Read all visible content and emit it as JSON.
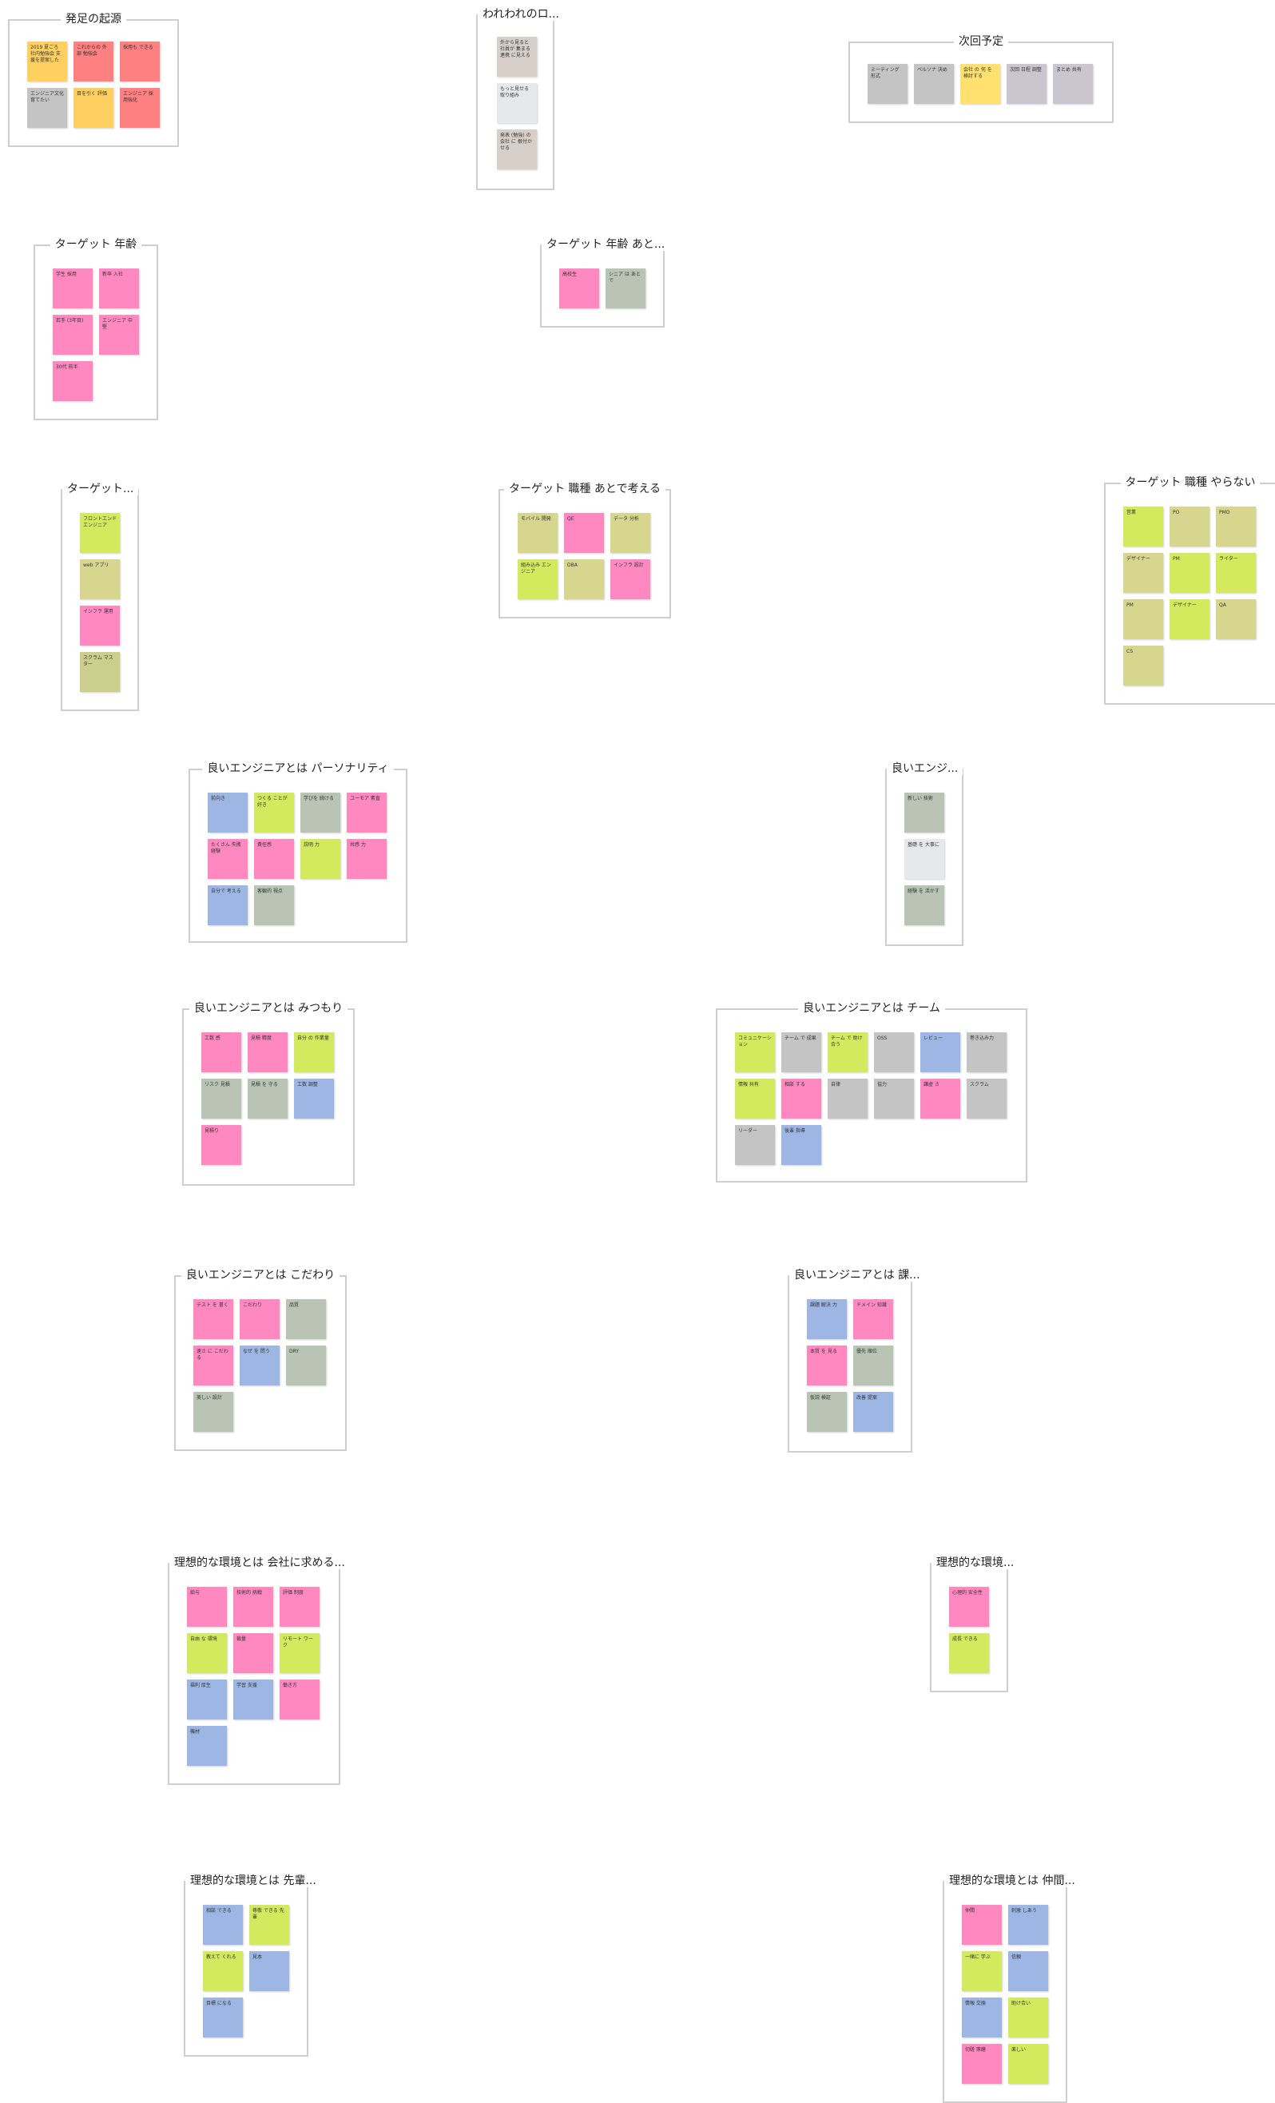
{
  "colors": {
    "pink": "#ff88c0",
    "red": "#ff8080",
    "orange": "#ffd060",
    "yellow": "#ffe070",
    "lime": "#d4ea5e",
    "khaki": "#d6d68e",
    "olive": "#cccf8c",
    "gray": "#c4c4c4",
    "sage": "#b9c4b4",
    "lightgray": "#e6e8ea",
    "blue": "#9db6e4",
    "mauve": "#c9c6cf",
    "tan": "#d8d0c8"
  },
  "frames": [
    {
      "id": "f1",
      "title": "発足の起源",
      "notes": [
        {
          "color": "orange",
          "text": "2019 夏ごろ 社内勉強会 支援を提案した"
        },
        {
          "color": "red",
          "text": "これからの 外部 勉強会"
        },
        {
          "color": "red",
          "text": "採用も できる"
        },
        {
          "color": "gray",
          "text": "エンジニア文化 育てたい"
        },
        {
          "color": "orange",
          "text": "目を引く 評価"
        },
        {
          "color": "red",
          "text": "エンジニア 採用強化"
        }
      ]
    },
    {
      "id": "f2",
      "title": "われわれのロ...",
      "notes": [
        {
          "color": "tan",
          "text": "外から見ると 社員が 集まる 連携 に見える"
        },
        {
          "color": "lightgray",
          "text": "もっと見せる 取り組み"
        },
        {
          "color": "tan",
          "text": "発表 (勉強) の 会社 に 根付かせる"
        }
      ]
    },
    {
      "id": "f3",
      "title": "次回予定",
      "notes": [
        {
          "color": "gray",
          "text": "ミーティング 形式"
        },
        {
          "color": "gray",
          "text": "ペルソナ 決め"
        },
        {
          "color": "yellow",
          "text": "会社 の 何 を 検討する"
        },
        {
          "color": "mauve",
          "text": "次回 日程 調整"
        },
        {
          "color": "mauve",
          "text": "まとめ 共有"
        }
      ]
    },
    {
      "id": "f4",
      "title": "ターゲット 年齢",
      "notes": [
        {
          "color": "pink",
          "text": "学生 採用"
        },
        {
          "color": "pink",
          "text": "新卒 入社"
        },
        {
          "color": "pink",
          "text": "若手 (3年目)"
        },
        {
          "color": "pink",
          "text": "エンジニア 中堅"
        },
        {
          "color": "pink",
          "text": "30代 前半"
        }
      ]
    },
    {
      "id": "f5",
      "title": "ターゲット 年齢 あと...",
      "notes": [
        {
          "color": "pink",
          "text": "高校生"
        },
        {
          "color": "sage",
          "text": "シニア は あとで"
        }
      ]
    },
    {
      "id": "f6",
      "title": "ターゲット...",
      "notes": [
        {
          "color": "lime",
          "text": "フロントエンド エンジニア"
        },
        {
          "color": "khaki",
          "text": "web アプリ"
        },
        {
          "color": "pink",
          "text": "インフラ 運用"
        },
        {
          "color": "olive",
          "text": "スクラム マスター"
        }
      ]
    },
    {
      "id": "f7",
      "title": "ターゲット 職種 あとで考える",
      "notes": [
        {
          "color": "khaki",
          "text": "モバイル 開発"
        },
        {
          "color": "pink",
          "text": "QE"
        },
        {
          "color": "khaki",
          "text": "データ 分析"
        },
        {
          "color": "lime",
          "text": "組み込み エンジニア"
        },
        {
          "color": "khaki",
          "text": "DBA"
        },
        {
          "color": "pink",
          "text": "インフラ 設計"
        }
      ]
    },
    {
      "id": "f8",
      "title": "ターゲット 職種 やらない",
      "notes": [
        {
          "color": "lime",
          "text": "営業"
        },
        {
          "color": "khaki",
          "text": "PO"
        },
        {
          "color": "khaki",
          "text": "PMO"
        },
        {
          "color": "khaki",
          "text": "デザイナー"
        },
        {
          "color": "lime",
          "text": "PM"
        },
        {
          "color": "lime",
          "text": "ライター"
        },
        {
          "color": "khaki",
          "text": "PM"
        },
        {
          "color": "lime",
          "text": "デザイナー"
        },
        {
          "color": "khaki",
          "text": "QA"
        },
        {
          "color": "khaki",
          "text": "CS"
        }
      ]
    },
    {
      "id": "f9",
      "title": "良いエンジニアとは パーソナリティ",
      "notes": [
        {
          "color": "blue",
          "text": "前向き"
        },
        {
          "color": "lime",
          "text": "つくる ことが好き"
        },
        {
          "color": "sage",
          "text": "学びを 続ける"
        },
        {
          "color": "pink",
          "text": "ユーモア 素直"
        },
        {
          "color": "pink",
          "text": "たくさん 失敗 経験"
        },
        {
          "color": "pink",
          "text": "責任感"
        },
        {
          "color": "lime",
          "text": "説明 力"
        },
        {
          "color": "pink",
          "text": "共感 力"
        },
        {
          "color": "blue",
          "text": "自分で 考える"
        },
        {
          "color": "sage",
          "text": "客観的 視点"
        }
      ]
    },
    {
      "id": "f10",
      "title": "良いエンジ...",
      "notes": [
        {
          "color": "sage",
          "text": "新しい 技術"
        },
        {
          "color": "lightgray",
          "text": "基礎 を 大事に"
        },
        {
          "color": "sage",
          "text": "経験 を 活かす"
        }
      ]
    },
    {
      "id": "f11",
      "title": "良いエンジニアとは みつもり",
      "notes": [
        {
          "color": "pink",
          "text": "工数 感"
        },
        {
          "color": "pink",
          "text": "見積 精度"
        },
        {
          "color": "lime",
          "text": "自分 の 作業量"
        },
        {
          "color": "sage",
          "text": "リスク 見積"
        },
        {
          "color": "sage",
          "text": "見積 を 守る"
        },
        {
          "color": "blue",
          "text": "工数 調整"
        },
        {
          "color": "pink",
          "text": "見積り"
        }
      ]
    },
    {
      "id": "f12",
      "title": "良いエンジニアとは チーム",
      "notes": [
        {
          "color": "lime",
          "text": "コミュニケーション"
        },
        {
          "color": "gray",
          "text": "チーム で 成果"
        },
        {
          "color": "lime",
          "text": "チーム で 助け合う"
        },
        {
          "color": "gray",
          "text": "OSS"
        },
        {
          "color": "blue",
          "text": "レビュー"
        },
        {
          "color": "gray",
          "text": "巻き込み力"
        },
        {
          "color": "lime",
          "text": "情報 共有"
        },
        {
          "color": "pink",
          "text": "相談 する"
        },
        {
          "color": "gray",
          "text": "自律"
        },
        {
          "color": "gray",
          "text": "協力"
        },
        {
          "color": "pink",
          "text": "謙虚 さ"
        },
        {
          "color": "gray",
          "text": "スクラム"
        },
        {
          "color": "gray",
          "text": "リーダー"
        },
        {
          "color": "blue",
          "text": "後輩 指導"
        }
      ]
    },
    {
      "id": "f13",
      "title": "良いエンジニアとは こだわり",
      "notes": [
        {
          "color": "pink",
          "text": "テスト を 書く"
        },
        {
          "color": "pink",
          "text": "こだわり"
        },
        {
          "color": "sage",
          "text": "品質"
        },
        {
          "color": "pink",
          "text": "速さ に こだわる"
        },
        {
          "color": "blue",
          "text": "なぜ を 問う"
        },
        {
          "color": "sage",
          "text": "DRY"
        },
        {
          "color": "sage",
          "text": "美しい 設計"
        }
      ]
    },
    {
      "id": "f14",
      "title": "良いエンジニアとは 課...",
      "notes": [
        {
          "color": "blue",
          "text": "課題 解決 力"
        },
        {
          "color": "pink",
          "text": "ドメイン 知識"
        },
        {
          "color": "pink",
          "text": "本質 を 見る"
        },
        {
          "color": "sage",
          "text": "優先 順位"
        },
        {
          "color": "sage",
          "text": "仮説 検証"
        },
        {
          "color": "blue",
          "text": "改善 提案"
        }
      ]
    },
    {
      "id": "f15",
      "title": "理想的な環境とは 会社に求める...",
      "notes": [
        {
          "color": "pink",
          "text": "給与"
        },
        {
          "color": "pink",
          "text": "技術的 挑戦"
        },
        {
          "color": "pink",
          "text": "評価 制度"
        },
        {
          "color": "lime",
          "text": "自由 な 環境"
        },
        {
          "color": "pink",
          "text": "裁量"
        },
        {
          "color": "lime",
          "text": "リモート ワーク"
        },
        {
          "color": "blue",
          "text": "福利 厚生"
        },
        {
          "color": "blue",
          "text": "学習 支援"
        },
        {
          "color": "pink",
          "text": "働き方"
        },
        {
          "color": "blue",
          "text": "機材"
        }
      ]
    },
    {
      "id": "f16",
      "title": "理想的な環境...",
      "notes": [
        {
          "color": "pink",
          "text": "心理的 安全性"
        },
        {
          "color": "lime",
          "text": "成長 できる"
        }
      ]
    },
    {
      "id": "f17",
      "title": "理想的な環境とは 先輩...",
      "notes": [
        {
          "color": "blue",
          "text": "相談 できる"
        },
        {
          "color": "lime",
          "text": "尊敬 できる 先輩"
        },
        {
          "color": "lime",
          "text": "教えて くれる"
        },
        {
          "color": "blue",
          "text": "見本"
        },
        {
          "color": "blue",
          "text": "目標 になる"
        }
      ]
    },
    {
      "id": "f18",
      "title": "理想的な環境とは 仲間...",
      "notes": [
        {
          "color": "pink",
          "text": "仲間"
        },
        {
          "color": "blue",
          "text": "刺激 しあう"
        },
        {
          "color": "lime",
          "text": "一緒に 学ぶ"
        },
        {
          "color": "blue",
          "text": "信頼"
        },
        {
          "color": "blue",
          "text": "情報 交換"
        },
        {
          "color": "lime",
          "text": "助け合い"
        },
        {
          "color": "pink",
          "text": "切磋 琢磨"
        },
        {
          "color": "lime",
          "text": "楽しい"
        }
      ]
    }
  ]
}
